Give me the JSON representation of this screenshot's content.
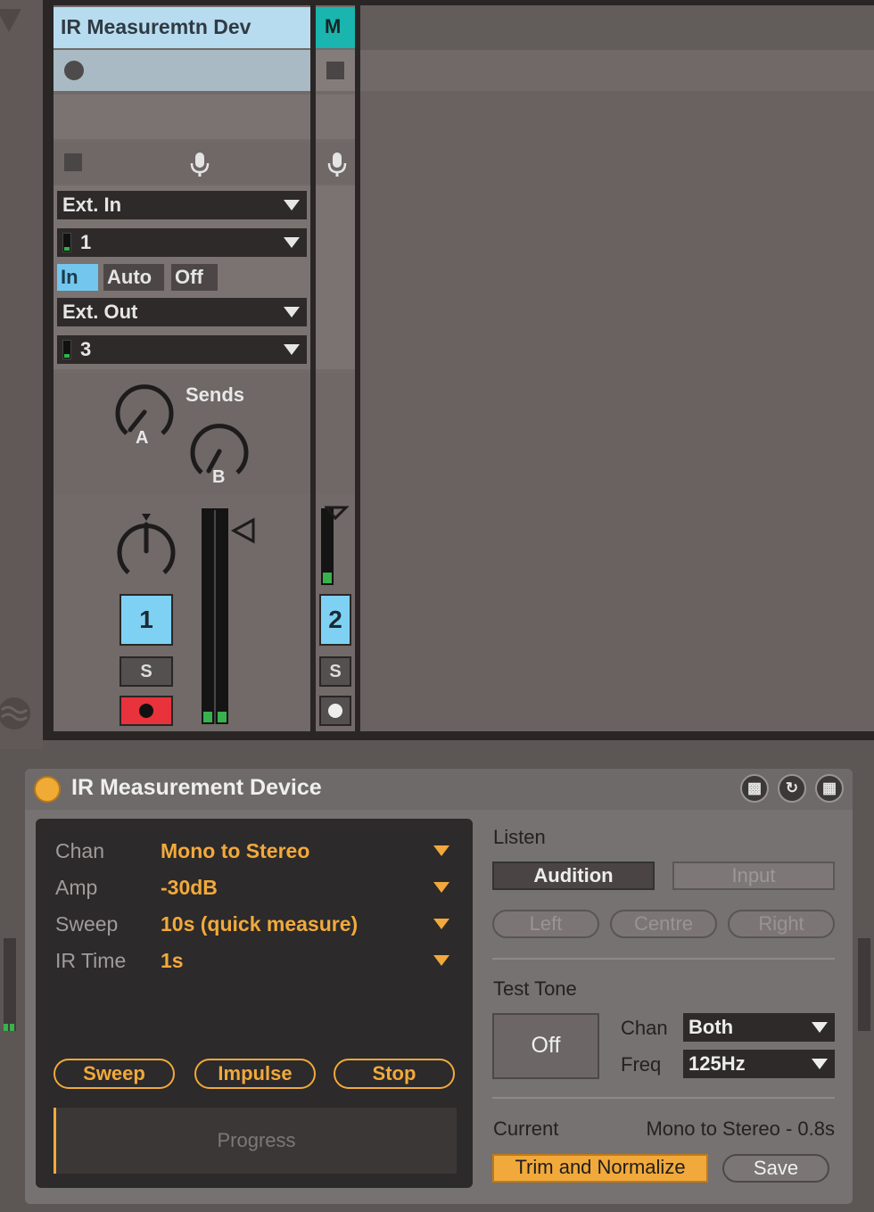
{
  "colors": {
    "track_title": "#b8dcef",
    "master_accent": "#19b5ae",
    "track_number": "#7fd1f3",
    "arm_red": "#e8323c",
    "device_accent": "#f2a93b"
  },
  "track1": {
    "title": "IR Measuremtn Dev",
    "input_type": "Ext. In",
    "input_channel": "1",
    "monitor": {
      "in": "In",
      "auto": "Auto",
      "off": "Off",
      "selected": "In"
    },
    "output_type": "Ext. Out",
    "output_channel": "3",
    "sends_label": "Sends",
    "send_a": "A",
    "send_b": "B",
    "number": "1",
    "solo": "S"
  },
  "track2": {
    "title": "M",
    "number": "2",
    "solo": "S"
  },
  "device": {
    "title": "IR Measurement Device",
    "settings": [
      {
        "label": "Chan",
        "value": "Mono to Stereo"
      },
      {
        "label": "Amp",
        "value": "-30dB"
      },
      {
        "label": "Sweep",
        "value": "10s (quick measure)"
      },
      {
        "label": "IR Time",
        "value": "1s"
      }
    ],
    "buttons": {
      "sweep": "Sweep",
      "impulse": "Impulse",
      "stop": "Stop"
    },
    "progress": "Progress",
    "listen": {
      "label": "Listen",
      "audition": "Audition",
      "input": "Input",
      "left": "Left",
      "centre": "Centre",
      "right": "Right"
    },
    "test_tone": {
      "label": "Test Tone",
      "off": "Off",
      "chan_label": "Chan",
      "chan_value": "Both",
      "freq_label": "Freq",
      "freq_value": "125Hz"
    },
    "current": {
      "label": "Current",
      "value": "Mono to Stereo - 0.8s",
      "trim": "Trim and Normalize",
      "save": "Save"
    }
  }
}
